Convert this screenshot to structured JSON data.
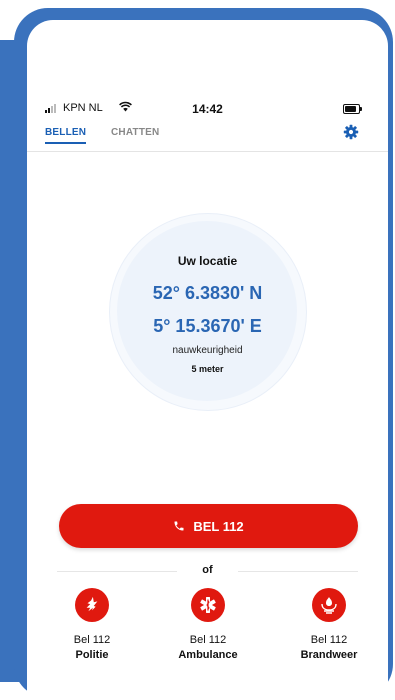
{
  "statusbar": {
    "carrier": "KPN NL",
    "time": "14:42"
  },
  "tabs": [
    {
      "label": "BELLEN",
      "active": true
    },
    {
      "label": "CHATTEN",
      "active": false
    }
  ],
  "location": {
    "title": "Uw locatie",
    "latitude": "52° 6.3830' N",
    "longitude": "5° 15.3670' E",
    "accuracy_label": "nauwkeurigheid",
    "accuracy_value": "5 meter"
  },
  "call_button": {
    "label": "BEL 112"
  },
  "separator": {
    "label": "of"
  },
  "services": [
    {
      "line1": "Bel 112",
      "line2": "Politie",
      "icon": "police-icon"
    },
    {
      "line1": "Bel 112",
      "line2": "Ambulance",
      "icon": "ambulance-star-of-life-icon"
    },
    {
      "line1": "Bel 112",
      "line2": "Brandweer",
      "icon": "fire-brigade-icon"
    }
  ],
  "colors": {
    "frame_blue": "#3a72bd",
    "accent_blue": "#2a66b3",
    "emergency_red": "#e0190f"
  }
}
